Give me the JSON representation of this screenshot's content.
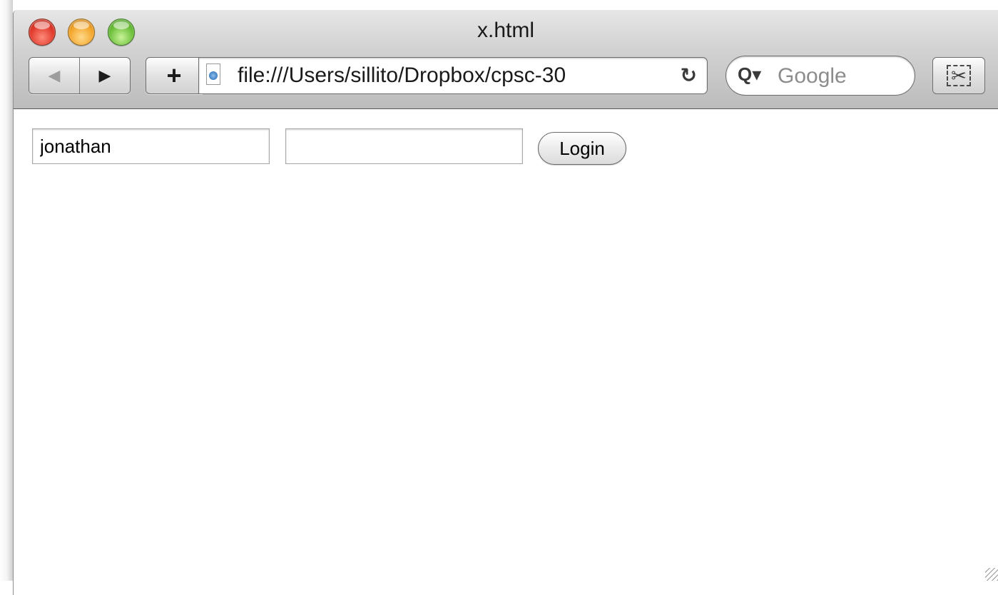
{
  "window": {
    "title": "x.html"
  },
  "toolbar": {
    "back_icon": "◀",
    "forward_icon": "▶",
    "add_icon": "+",
    "url": "file:///Users/sillito/Dropbox/cpsc-30",
    "reload_icon": "↻",
    "search_icon": "Q▾",
    "search_placeholder": "Google",
    "clip_icon": "✂"
  },
  "form": {
    "username_value": "jonathan",
    "password_value": "",
    "login_label": "Login"
  }
}
